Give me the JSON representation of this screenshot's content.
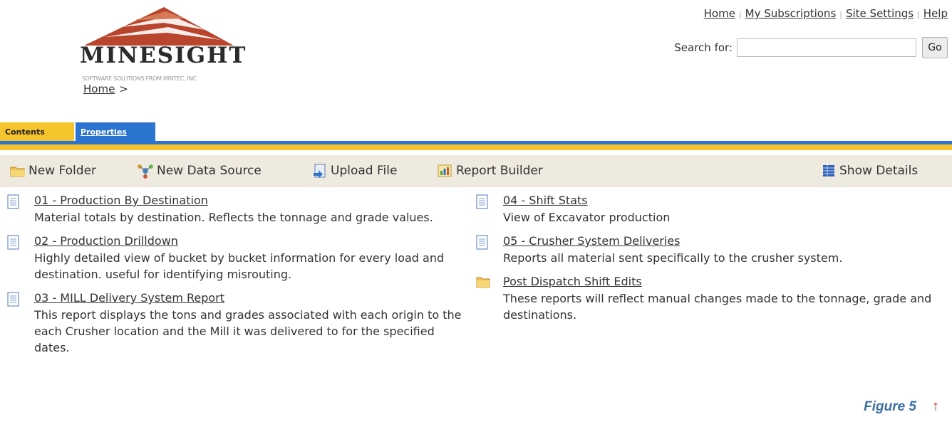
{
  "logo": {
    "word": "MINESIGHT",
    "tagline": "SOFTWARE SOLUTIONS FROM MINTEC, INC."
  },
  "breadcrumb": {
    "home": "Home",
    "sep": ">"
  },
  "toplinks": {
    "home": "Home",
    "subscriptions": "My Subscriptions",
    "settings": "Site Settings",
    "help": "Help"
  },
  "search": {
    "label": "Search for:",
    "value": "",
    "go": "Go"
  },
  "tabs": {
    "contents": "Contents",
    "properties": "Properties"
  },
  "toolbar": {
    "new_folder": "New Folder",
    "new_data_source": "New Data Source",
    "upload_file": "Upload File",
    "report_builder": "Report Builder",
    "show_details": "Show Details"
  },
  "items": [
    {
      "title": "01 - Production By Destination",
      "desc": "Material totals by destination. Reflects the tonnage and grade values.",
      "icon": "report-icon"
    },
    {
      "title": "02 - Production Drilldown",
      "desc": "Highly detailed view of bucket by bucket information for every load and destination. useful for identifying misrouting.",
      "icon": "report-icon"
    },
    {
      "title": "03 - MILL Delivery System Report",
      "desc": "This report displays the tons and grades associated with each origin to the each Crusher location and the Mill it was delivered to for the specified dates.",
      "icon": "report-icon"
    },
    {
      "title": "04 - Shift Stats",
      "desc": "View of Excavator production",
      "icon": "report-icon"
    },
    {
      "title": "05 - Crusher System Deliveries",
      "desc": "Reports all material sent specifically to the crusher system.",
      "icon": "report-icon"
    },
    {
      "title": "Post Dispatch Shift Edits",
      "desc": "These reports will reflect manual changes made to the tonnage, grade and destinations.",
      "icon": "folder-icon"
    }
  ],
  "caption": {
    "text": "Figure 5",
    "arrow": "↑"
  },
  "colors": {
    "tab_yellow": "#f5c32b",
    "tab_blue": "#2b74cf",
    "toolbar_bg": "#efeae0",
    "caption": "#3b6ea5",
    "logo_red": "#b8452c"
  }
}
